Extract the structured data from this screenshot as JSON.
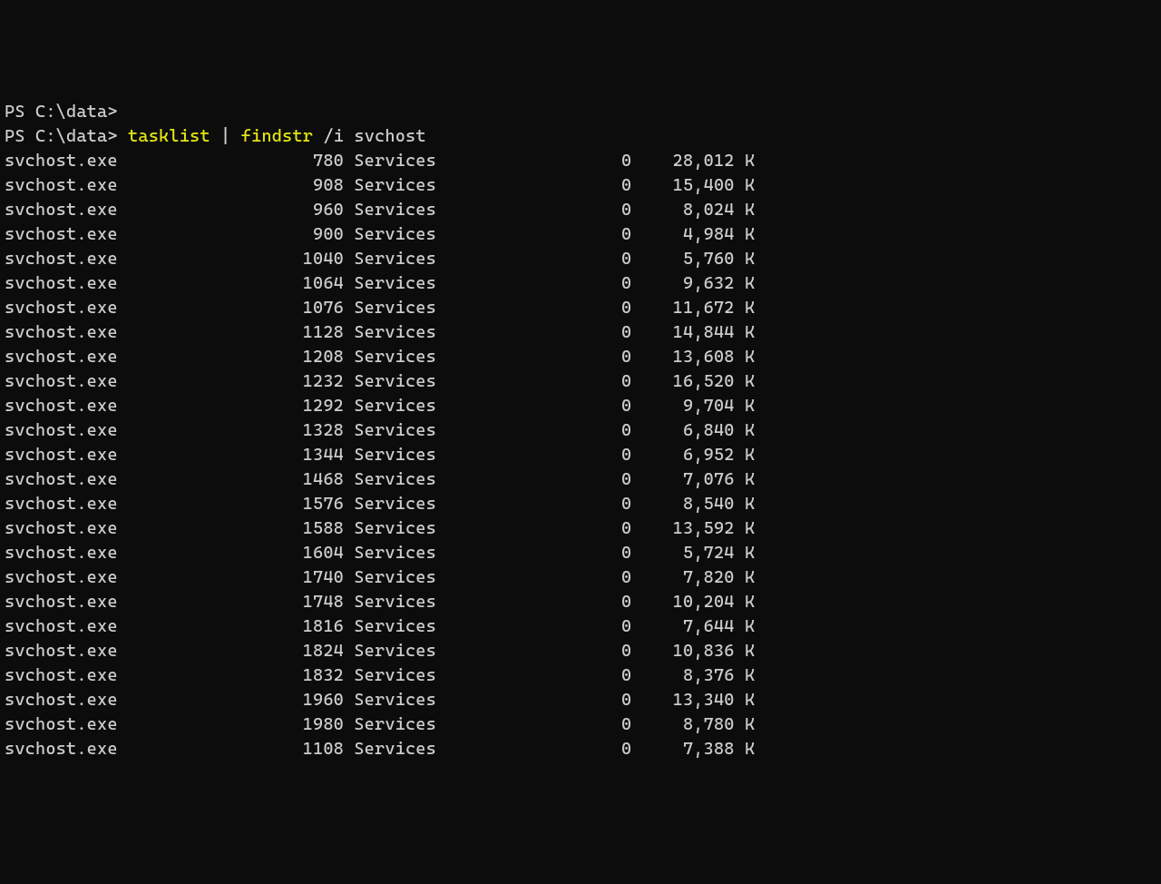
{
  "prompt_prefix": "PS ",
  "prompt_path": "C:\\data",
  "prompt_suffix": ">",
  "command": {
    "cmd1": "tasklist",
    "pipe": " | ",
    "cmd2": "findstr",
    "args": " /i svchost"
  },
  "rows": [
    {
      "image": "svchost.exe",
      "pid": "780",
      "session_name": "Services",
      "session_num": "0",
      "mem": "28,012 K"
    },
    {
      "image": "svchost.exe",
      "pid": "908",
      "session_name": "Services",
      "session_num": "0",
      "mem": "15,400 K"
    },
    {
      "image": "svchost.exe",
      "pid": "960",
      "session_name": "Services",
      "session_num": "0",
      "mem": "8,024 K"
    },
    {
      "image": "svchost.exe",
      "pid": "900",
      "session_name": "Services",
      "session_num": "0",
      "mem": "4,984 K"
    },
    {
      "image": "svchost.exe",
      "pid": "1040",
      "session_name": "Services",
      "session_num": "0",
      "mem": "5,760 K"
    },
    {
      "image": "svchost.exe",
      "pid": "1064",
      "session_name": "Services",
      "session_num": "0",
      "mem": "9,632 K"
    },
    {
      "image": "svchost.exe",
      "pid": "1076",
      "session_name": "Services",
      "session_num": "0",
      "mem": "11,672 K"
    },
    {
      "image": "svchost.exe",
      "pid": "1128",
      "session_name": "Services",
      "session_num": "0",
      "mem": "14,844 K"
    },
    {
      "image": "svchost.exe",
      "pid": "1208",
      "session_name": "Services",
      "session_num": "0",
      "mem": "13,608 K"
    },
    {
      "image": "svchost.exe",
      "pid": "1232",
      "session_name": "Services",
      "session_num": "0",
      "mem": "16,520 K"
    },
    {
      "image": "svchost.exe",
      "pid": "1292",
      "session_name": "Services",
      "session_num": "0",
      "mem": "9,704 K"
    },
    {
      "image": "svchost.exe",
      "pid": "1328",
      "session_name": "Services",
      "session_num": "0",
      "mem": "6,840 K"
    },
    {
      "image": "svchost.exe",
      "pid": "1344",
      "session_name": "Services",
      "session_num": "0",
      "mem": "6,952 K"
    },
    {
      "image": "svchost.exe",
      "pid": "1468",
      "session_name": "Services",
      "session_num": "0",
      "mem": "7,076 K"
    },
    {
      "image": "svchost.exe",
      "pid": "1576",
      "session_name": "Services",
      "session_num": "0",
      "mem": "8,540 K"
    },
    {
      "image": "svchost.exe",
      "pid": "1588",
      "session_name": "Services",
      "session_num": "0",
      "mem": "13,592 K"
    },
    {
      "image": "svchost.exe",
      "pid": "1604",
      "session_name": "Services",
      "session_num": "0",
      "mem": "5,724 K"
    },
    {
      "image": "svchost.exe",
      "pid": "1740",
      "session_name": "Services",
      "session_num": "0",
      "mem": "7,820 K"
    },
    {
      "image": "svchost.exe",
      "pid": "1748",
      "session_name": "Services",
      "session_num": "0",
      "mem": "10,204 K"
    },
    {
      "image": "svchost.exe",
      "pid": "1816",
      "session_name": "Services",
      "session_num": "0",
      "mem": "7,644 K"
    },
    {
      "image": "svchost.exe",
      "pid": "1824",
      "session_name": "Services",
      "session_num": "0",
      "mem": "10,836 K"
    },
    {
      "image": "svchost.exe",
      "pid": "1832",
      "session_name": "Services",
      "session_num": "0",
      "mem": "8,376 K"
    },
    {
      "image": "svchost.exe",
      "pid": "1960",
      "session_name": "Services",
      "session_num": "0",
      "mem": "13,340 K"
    },
    {
      "image": "svchost.exe",
      "pid": "1980",
      "session_name": "Services",
      "session_num": "0",
      "mem": "8,780 K"
    },
    {
      "image": "svchost.exe",
      "pid": "1108",
      "session_name": "Services",
      "session_num": "0",
      "mem": "7,388 K"
    }
  ],
  "col_widths": {
    "image": 25,
    "pid": 8,
    "session_name": 16,
    "session_num": 11,
    "mem": 12
  }
}
